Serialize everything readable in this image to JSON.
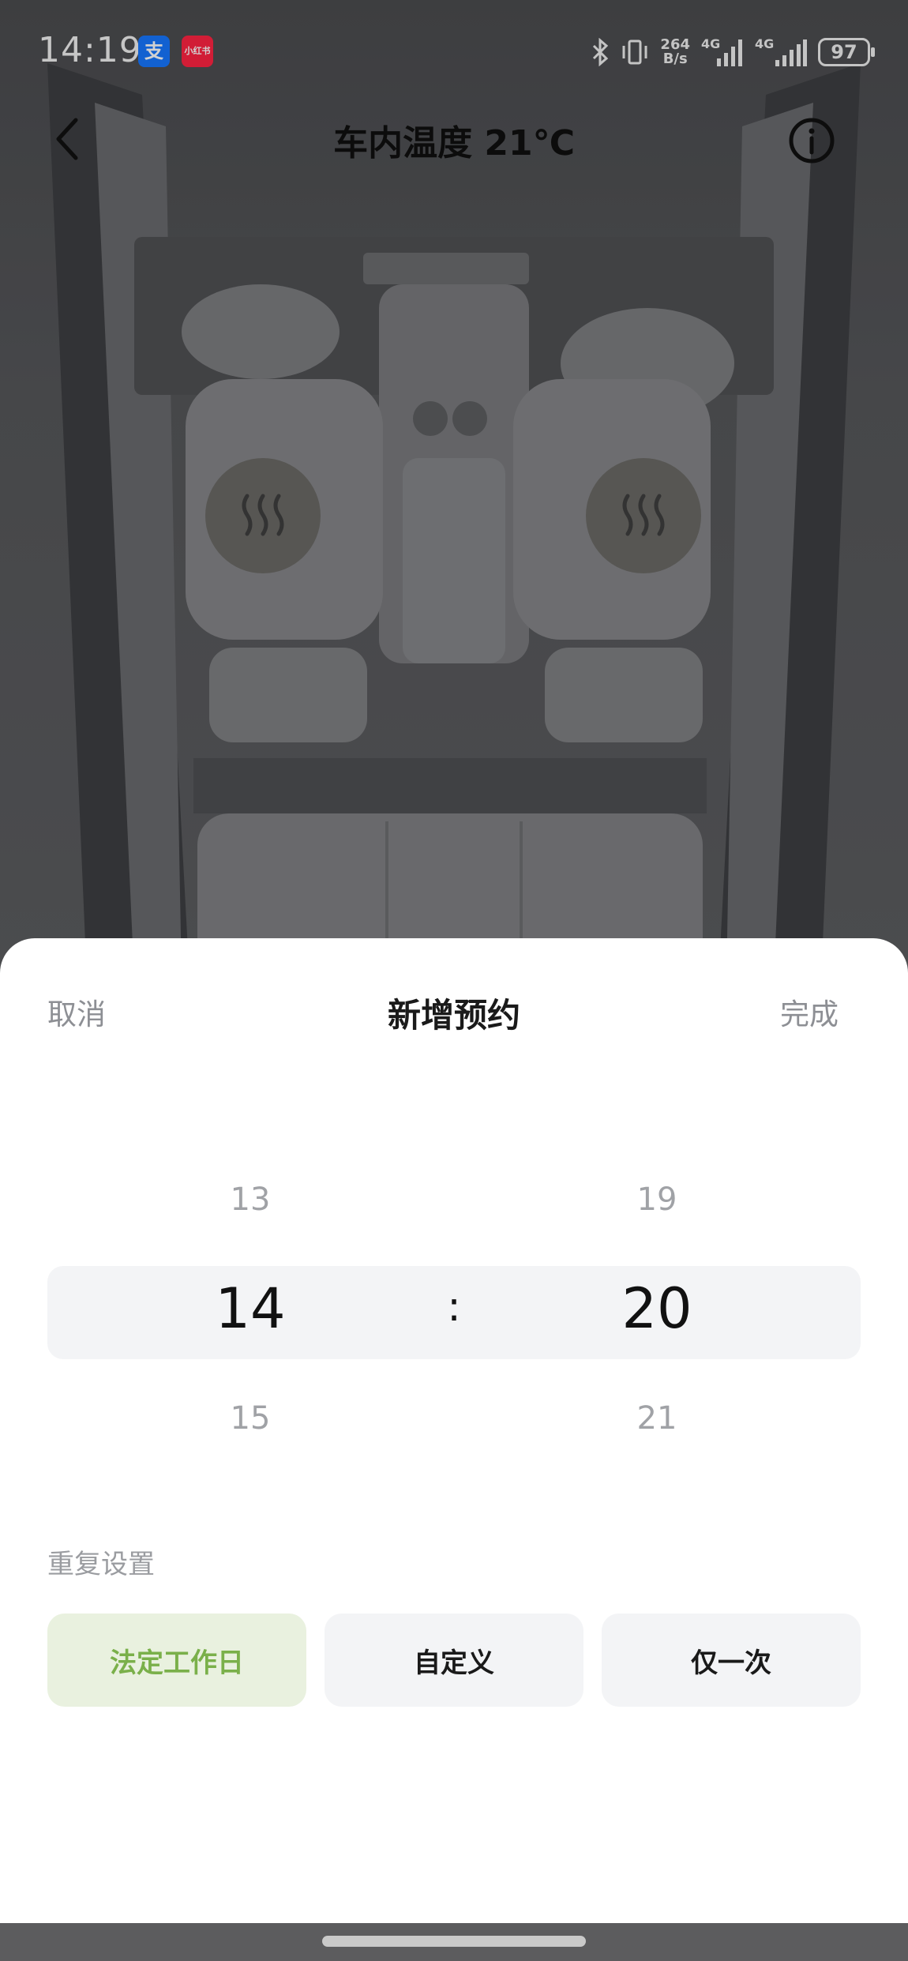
{
  "status_bar": {
    "time": "14:19",
    "apps": [
      {
        "name": "alipay-icon",
        "glyph": "支",
        "color": "#1677ff"
      },
      {
        "name": "xiaohongshu-icon",
        "glyph": "小红书",
        "color": "#ff2442"
      }
    ],
    "net_speed_value": "264",
    "net_speed_unit": "B/s",
    "signal_1": "4G",
    "signal_2": "4G",
    "battery": "97"
  },
  "header": {
    "title": "车内温度 21℃",
    "back_icon": "chevron-left-icon",
    "info_icon": "info-icon"
  },
  "seat_heat": {
    "icon": "seat-heat-icon"
  },
  "sheet": {
    "cancel_label": "取消",
    "title": "新增预约",
    "done_label": "完成",
    "hour_picker": {
      "prev": "13",
      "selected": "14",
      "next": "15"
    },
    "minute_picker": {
      "prev": "19",
      "selected": "20",
      "next": "21"
    },
    "separator": ":",
    "repeat_label": "重复设置",
    "repeat_options": [
      {
        "label": "法定工作日",
        "active": true
      },
      {
        "label": "自定义",
        "active": false
      },
      {
        "label": "仅一次",
        "active": false
      }
    ],
    "accent_color": "#7ab04a"
  }
}
